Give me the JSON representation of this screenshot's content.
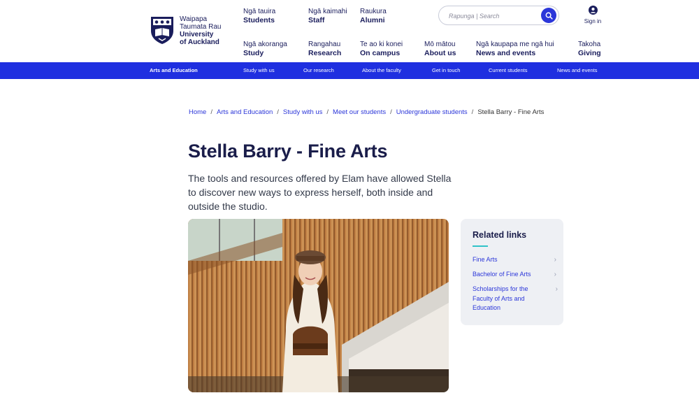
{
  "brand": {
    "line1": "Waipapa",
    "line2": "Taumata Rau",
    "line3": "University",
    "line4": "of Auckland"
  },
  "topnav": [
    {
      "mi": "Ngā tauira",
      "en": "Students"
    },
    {
      "mi": "Ngā kaimahi",
      "en": "Staff"
    },
    {
      "mi": "Raukura",
      "en": "Alumni"
    }
  ],
  "mainnav": [
    {
      "mi": "Ngā akoranga",
      "en": "Study"
    },
    {
      "mi": "Rangahau",
      "en": "Research"
    },
    {
      "mi": "Te ao ki konei",
      "en": "On campus"
    },
    {
      "mi": "Mō mātou",
      "en": "About us"
    },
    {
      "mi": "Ngā kaupapa me ngā hui",
      "en": "News and events"
    },
    {
      "mi": "Takoha",
      "en": "Giving"
    }
  ],
  "search": {
    "placeholder": "Rapunga | Search"
  },
  "signin": {
    "label": "Sign in"
  },
  "subnav": {
    "section": "Arts and Education",
    "items": [
      "Study with us",
      "Our research",
      "About the faculty",
      "Get in touch",
      "Current students",
      "News and events"
    ]
  },
  "breadcrumb": [
    "Home",
    "Arts and Education",
    "Study with us",
    "Meet our students",
    "Undergraduate students",
    "Stella Barry - Fine Arts"
  ],
  "page": {
    "title": "Stella Barry - Fine Arts",
    "lead": "The tools and resources offered by Elam have allowed Stella to discover new ways to express herself, both inside and outside the studio."
  },
  "related": {
    "heading": "Related links",
    "links": [
      "Fine Arts",
      "Bachelor of Fine Arts",
      "Scholarships for the Faculty of Arts and Education"
    ]
  },
  "colors": {
    "brand_navy": "#1a1d5c",
    "accent_blue": "#1f2fe0",
    "teal": "#2fc2c9"
  }
}
